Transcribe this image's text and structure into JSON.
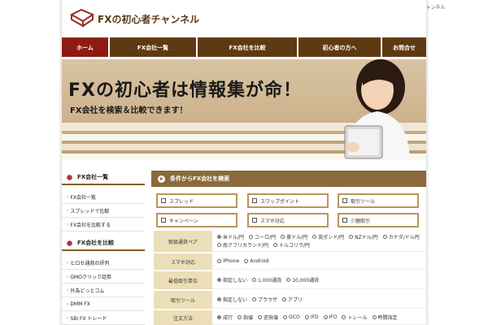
{
  "site_description": "FXの初心者チャンネル",
  "logo": {
    "text": "FXの初心者チャンネル"
  },
  "nav": [
    {
      "label": "ホーム",
      "active": true
    },
    {
      "label": "FX会社一覧",
      "active": false
    },
    {
      "label": "FX会社を比較",
      "active": false
    },
    {
      "label": "初心者の方へ",
      "active": false
    },
    {
      "label": "お問合せ",
      "active": false
    }
  ],
  "hero": {
    "title": "FXの初心者は情報集が命！",
    "subtitle": "FX会社を検索＆比較できます！"
  },
  "sidebar": {
    "section1": {
      "heading": "FX会社一覧",
      "items": [
        "FX会社一覧",
        "スプレッドで比較",
        "FX会社を比較する"
      ]
    },
    "section2": {
      "heading": "FX会社を比較",
      "items": [
        "ヒロセ通商の評判",
        "GMOクリック証券",
        "外為どっとコム",
        "DMM FX",
        "SBI FX トレード"
      ]
    }
  },
  "search": {
    "heading": "条件からFX会社を検索",
    "checkboxes": [
      "スプレッド",
      "スワップポイント",
      "取引ツール",
      "キャンペーン",
      "スマホ対応",
      "少額取引"
    ],
    "filters": [
      {
        "label": "取扱通貨ペア",
        "options": [
          "米ドル/円",
          "ユーロ/円",
          "豪ドル/円",
          "英ポンド/円",
          "NZドル/円",
          "カナダ/ドル円",
          "南アフリカランド/円",
          "トルコリラ/円"
        ],
        "selected": 0
      },
      {
        "label": "スマホ対応",
        "options": [
          "iPhone",
          "Android"
        ],
        "selected": -1
      },
      {
        "label": "最低取引単位",
        "options": [
          "指定しない",
          "1,000通貨",
          "10,000通貨"
        ],
        "selected": 0
      },
      {
        "label": "取引ツール",
        "options": [
          "指定しない",
          "ブラウザ",
          "アプリ"
        ],
        "selected": 0
      },
      {
        "label": "注文方法",
        "options": [
          "成行",
          "指値",
          "逆指値",
          "OCO",
          "IFD",
          "IFO",
          "トレール",
          "時間指定"
        ],
        "selected": 0
      }
    ]
  },
  "colors": {
    "nav_bg": "#5e3a12",
    "nav_active": "#8e1a12",
    "search_head": "#8a6a3a",
    "filter_label_bg": "#ecdfb8",
    "checkbox_border": "#b8965a"
  }
}
